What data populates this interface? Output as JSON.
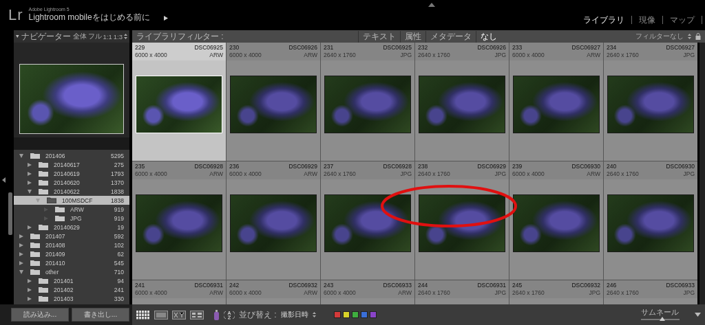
{
  "app": {
    "logo": "Lr",
    "product": "Adobe Lightroom 5",
    "subtitle": "Lightroom mobileをはじめる前に"
  },
  "modules": [
    {
      "label": "ライブラリ",
      "selected": true
    },
    {
      "label": "現像",
      "selected": false
    },
    {
      "label": "マップ",
      "selected": false
    }
  ],
  "navigator": {
    "title": "ナビゲーター",
    "zoom_options": [
      "全体",
      "フル",
      "1:1",
      "1:3"
    ]
  },
  "folders": [
    {
      "name": "201406",
      "count": "5295",
      "expanded": true,
      "selected": false,
      "children": [
        {
          "name": "20140617",
          "count": "275",
          "expanded": false,
          "selected": false
        },
        {
          "name": "20140619",
          "count": "1793",
          "expanded": false,
          "selected": false
        },
        {
          "name": "20140620",
          "count": "1370",
          "expanded": false,
          "selected": false
        },
        {
          "name": "20140622",
          "count": "1838",
          "expanded": true,
          "selected": false,
          "children": [
            {
              "name": "100MSDCF",
              "count": "1838",
              "expanded": true,
              "selected": true,
              "children": [
                {
                  "name": "ARW",
                  "count": "919",
                  "expanded": false,
                  "selected": false
                },
                {
                  "name": "JPG",
                  "count": "919",
                  "expanded": false,
                  "selected": false
                }
              ]
            }
          ]
        },
        {
          "name": "20140629",
          "count": "19",
          "expanded": false,
          "selected": false
        }
      ]
    },
    {
      "name": "201407",
      "count": "592",
      "expanded": false,
      "selected": false
    },
    {
      "name": "201408",
      "count": "102",
      "expanded": false,
      "selected": false
    },
    {
      "name": "201409",
      "count": "62",
      "expanded": false,
      "selected": false
    },
    {
      "name": "201410",
      "count": "545",
      "expanded": false,
      "selected": false
    },
    {
      "name": "other",
      "count": "710",
      "expanded": true,
      "selected": false,
      "children": [
        {
          "name": "201401",
          "count": "94",
          "expanded": false,
          "selected": false
        },
        {
          "name": "201402",
          "count": "241",
          "expanded": false,
          "selected": false
        },
        {
          "name": "201403",
          "count": "330",
          "expanded": false,
          "selected": false
        }
      ]
    }
  ],
  "buttons": [
    "読み込み...",
    "書き出し..."
  ],
  "filter_bar": {
    "label": "ライブラリフィルター :",
    "tabs": [
      {
        "label": "テキスト",
        "selected": false
      },
      {
        "label": "属性",
        "selected": false
      },
      {
        "label": "メタデータ",
        "selected": false
      },
      {
        "label": "なし",
        "selected": true
      }
    ],
    "preset": "フィルターなし"
  },
  "grid": {
    "cells": [
      {
        "index": "229",
        "file": "DSC06925",
        "size": "6000 x 4000",
        "ext": "ARW",
        "selected": true
      },
      {
        "index": "230",
        "file": "DSC06926",
        "size": "6000 x 4000",
        "ext": "ARW",
        "selected": false
      },
      {
        "index": "231",
        "file": "DSC06925",
        "size": "2640 x 1760",
        "ext": "JPG",
        "selected": false
      },
      {
        "index": "232",
        "file": "DSC06926",
        "size": "2640 x 1760",
        "ext": "JPG",
        "selected": false
      },
      {
        "index": "233",
        "file": "DSC06927",
        "size": "6000 x 4000",
        "ext": "ARW",
        "selected": false
      },
      {
        "index": "234",
        "file": "DSC06927",
        "size": "2640 x 1760",
        "ext": "JPG",
        "selected": false
      },
      {
        "index": "235",
        "file": "DSC06928",
        "size": "6000 x 4000",
        "ext": "ARW",
        "selected": false
      },
      {
        "index": "236",
        "file": "DSC06929",
        "size": "6000 x 4000",
        "ext": "ARW",
        "selected": false
      },
      {
        "index": "237",
        "file": "DSC06928",
        "size": "2640 x 1760",
        "ext": "JPG",
        "selected": false
      },
      {
        "index": "238",
        "file": "DSC06929",
        "size": "2640 x 1760",
        "ext": "JPG",
        "selected": false
      },
      {
        "index": "239",
        "file": "DSC06930",
        "size": "6000 x 4000",
        "ext": "ARW",
        "selected": false
      },
      {
        "index": "240",
        "file": "DSC06930",
        "size": "2640 x 1760",
        "ext": "JPG",
        "selected": false
      },
      {
        "index": "241",
        "file": "DSC06931",
        "size": "6000 x 4000",
        "ext": "ARW",
        "selected": false
      },
      {
        "index": "242",
        "file": "DSC06932",
        "size": "6000 x 4000",
        "ext": "ARW",
        "selected": false
      },
      {
        "index": "243",
        "file": "DSC06933",
        "size": "6000 x 4000",
        "ext": "ARW",
        "selected": false
      },
      {
        "index": "244",
        "file": "DSC06931",
        "size": "2640 x 1760",
        "ext": "JPG",
        "selected": false
      },
      {
        "index": "245",
        "file": "DSC06932",
        "size": "2640 x 1760",
        "ext": "JPG",
        "selected": false
      },
      {
        "index": "246",
        "file": "DSC06933",
        "size": "2640 x 1760",
        "ext": "JPG",
        "selected": false
      }
    ]
  },
  "toolbar": {
    "sort_label": "並び替え :",
    "sort_value": "撮影日時",
    "color_labels": [
      {
        "color": "#d43a3a"
      },
      {
        "color": "#d8d22a"
      },
      {
        "color": "#3fae3f"
      },
      {
        "color": "#3a6fd8"
      },
      {
        "color": "#8a44c8"
      }
    ],
    "thumbnail_label": "サムネール",
    "thumbnail_size": {
      "level": 0.55
    }
  }
}
